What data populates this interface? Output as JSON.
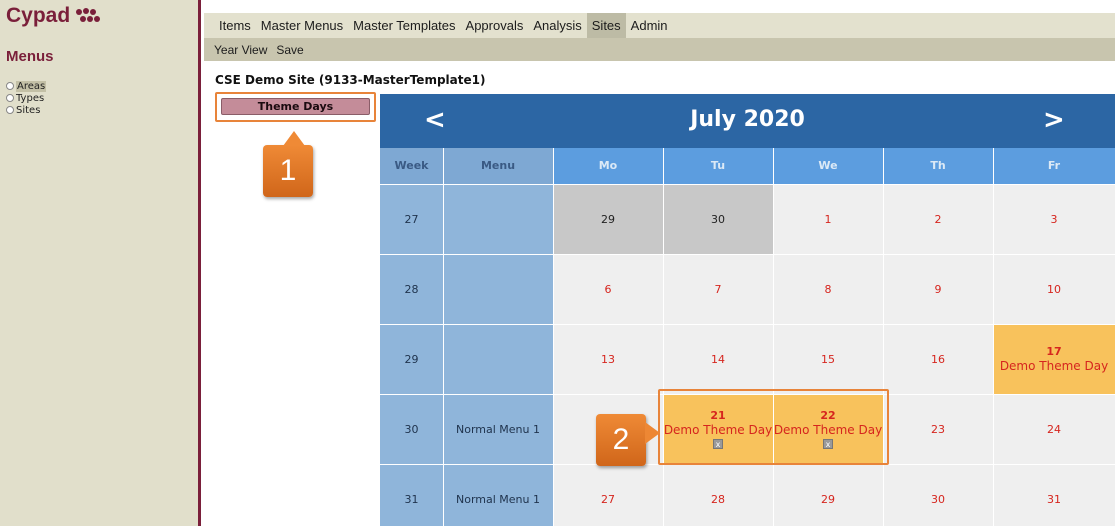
{
  "brand": {
    "name": "Cypad"
  },
  "sidebar": {
    "title": "Menus",
    "items": [
      {
        "label": "Areas",
        "active": true
      },
      {
        "label": "Types",
        "active": false
      },
      {
        "label": "Sites",
        "active": false
      }
    ]
  },
  "topnav": {
    "tabs": [
      {
        "label": "Items",
        "active": false
      },
      {
        "label": "Master Menus",
        "active": false
      },
      {
        "label": "Master Templates",
        "active": false
      },
      {
        "label": "Approvals",
        "active": false
      },
      {
        "label": "Analysis",
        "active": false
      },
      {
        "label": "Sites",
        "active": true
      },
      {
        "label": "Admin",
        "active": false
      }
    ]
  },
  "subnav": {
    "year_view": "Year View",
    "save": "Save"
  },
  "site_title": "CSE Demo Site (9133-MasterTemplate1)",
  "theme_days_button": "Theme Days",
  "callouts": [
    "1",
    "2"
  ],
  "calendar": {
    "prev": "<",
    "next": ">",
    "month": "July 2020",
    "headers": {
      "week": "Week",
      "menu": "Menu",
      "days": [
        "Mo",
        "Tu",
        "We",
        "Th",
        "Fr"
      ]
    },
    "rows": [
      {
        "week": "27",
        "menu": "",
        "days": [
          {
            "day": "29",
            "state": "past",
            "label": ""
          },
          {
            "day": "30",
            "state": "past",
            "label": ""
          },
          {
            "day": "1",
            "state": "normal",
            "label": ""
          },
          {
            "day": "2",
            "state": "normal",
            "label": ""
          },
          {
            "day": "3",
            "state": "normal",
            "label": ""
          }
        ]
      },
      {
        "week": "28",
        "menu": "",
        "days": [
          {
            "day": "6",
            "state": "normal",
            "label": ""
          },
          {
            "day": "7",
            "state": "normal",
            "label": ""
          },
          {
            "day": "8",
            "state": "normal",
            "label": ""
          },
          {
            "day": "9",
            "state": "normal",
            "label": ""
          },
          {
            "day": "10",
            "state": "normal",
            "label": ""
          }
        ]
      },
      {
        "week": "29",
        "menu": "",
        "days": [
          {
            "day": "13",
            "state": "normal",
            "label": ""
          },
          {
            "day": "14",
            "state": "normal",
            "label": ""
          },
          {
            "day": "15",
            "state": "normal",
            "label": ""
          },
          {
            "day": "16",
            "state": "normal",
            "label": ""
          },
          {
            "day": "17",
            "state": "theme",
            "label": "Demo Theme Day",
            "removable": false
          }
        ]
      },
      {
        "week": "30",
        "menu": "Normal Menu 1",
        "days": [
          {
            "day": "20",
            "state": "hidden",
            "label": ""
          },
          {
            "day": "21",
            "state": "theme",
            "label": "Demo Theme Day",
            "removable": true,
            "remove_glyph": "x"
          },
          {
            "day": "22",
            "state": "theme",
            "label": "Demo Theme Day",
            "removable": true,
            "remove_glyph": "x"
          },
          {
            "day": "23",
            "state": "normal",
            "label": ""
          },
          {
            "day": "24",
            "state": "normal",
            "label": ""
          }
        ]
      },
      {
        "week": "31",
        "menu": "Normal Menu 1",
        "days": [
          {
            "day": "27",
            "state": "normal",
            "label": ""
          },
          {
            "day": "28",
            "state": "normal",
            "label": ""
          },
          {
            "day": "29",
            "state": "normal",
            "label": ""
          },
          {
            "day": "30",
            "state": "normal",
            "label": ""
          },
          {
            "day": "31",
            "state": "normal",
            "label": ""
          }
        ]
      }
    ]
  },
  "colors": {
    "brand": "#7a1f3a",
    "header_blue": "#2c66a4",
    "theme_day": "#f8c25c",
    "date_red": "#d6251e",
    "callout": "#e8843a"
  }
}
